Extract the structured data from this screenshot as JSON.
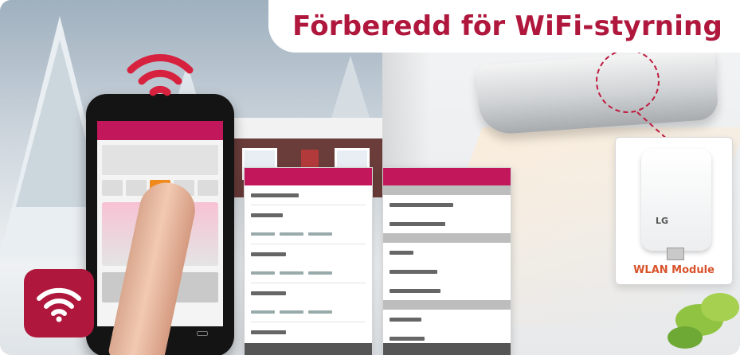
{
  "banner": {
    "title": "Förberedd för WiFi-styrning"
  },
  "module": {
    "label": "WLAN Module",
    "logo_text": "LG"
  },
  "colors": {
    "brand": "#b0173d",
    "app_header": "#c2185b",
    "module_label": "#d8522a"
  },
  "icons": {
    "badge": "wifi-icon",
    "signal": "wifi-signal-icon"
  }
}
